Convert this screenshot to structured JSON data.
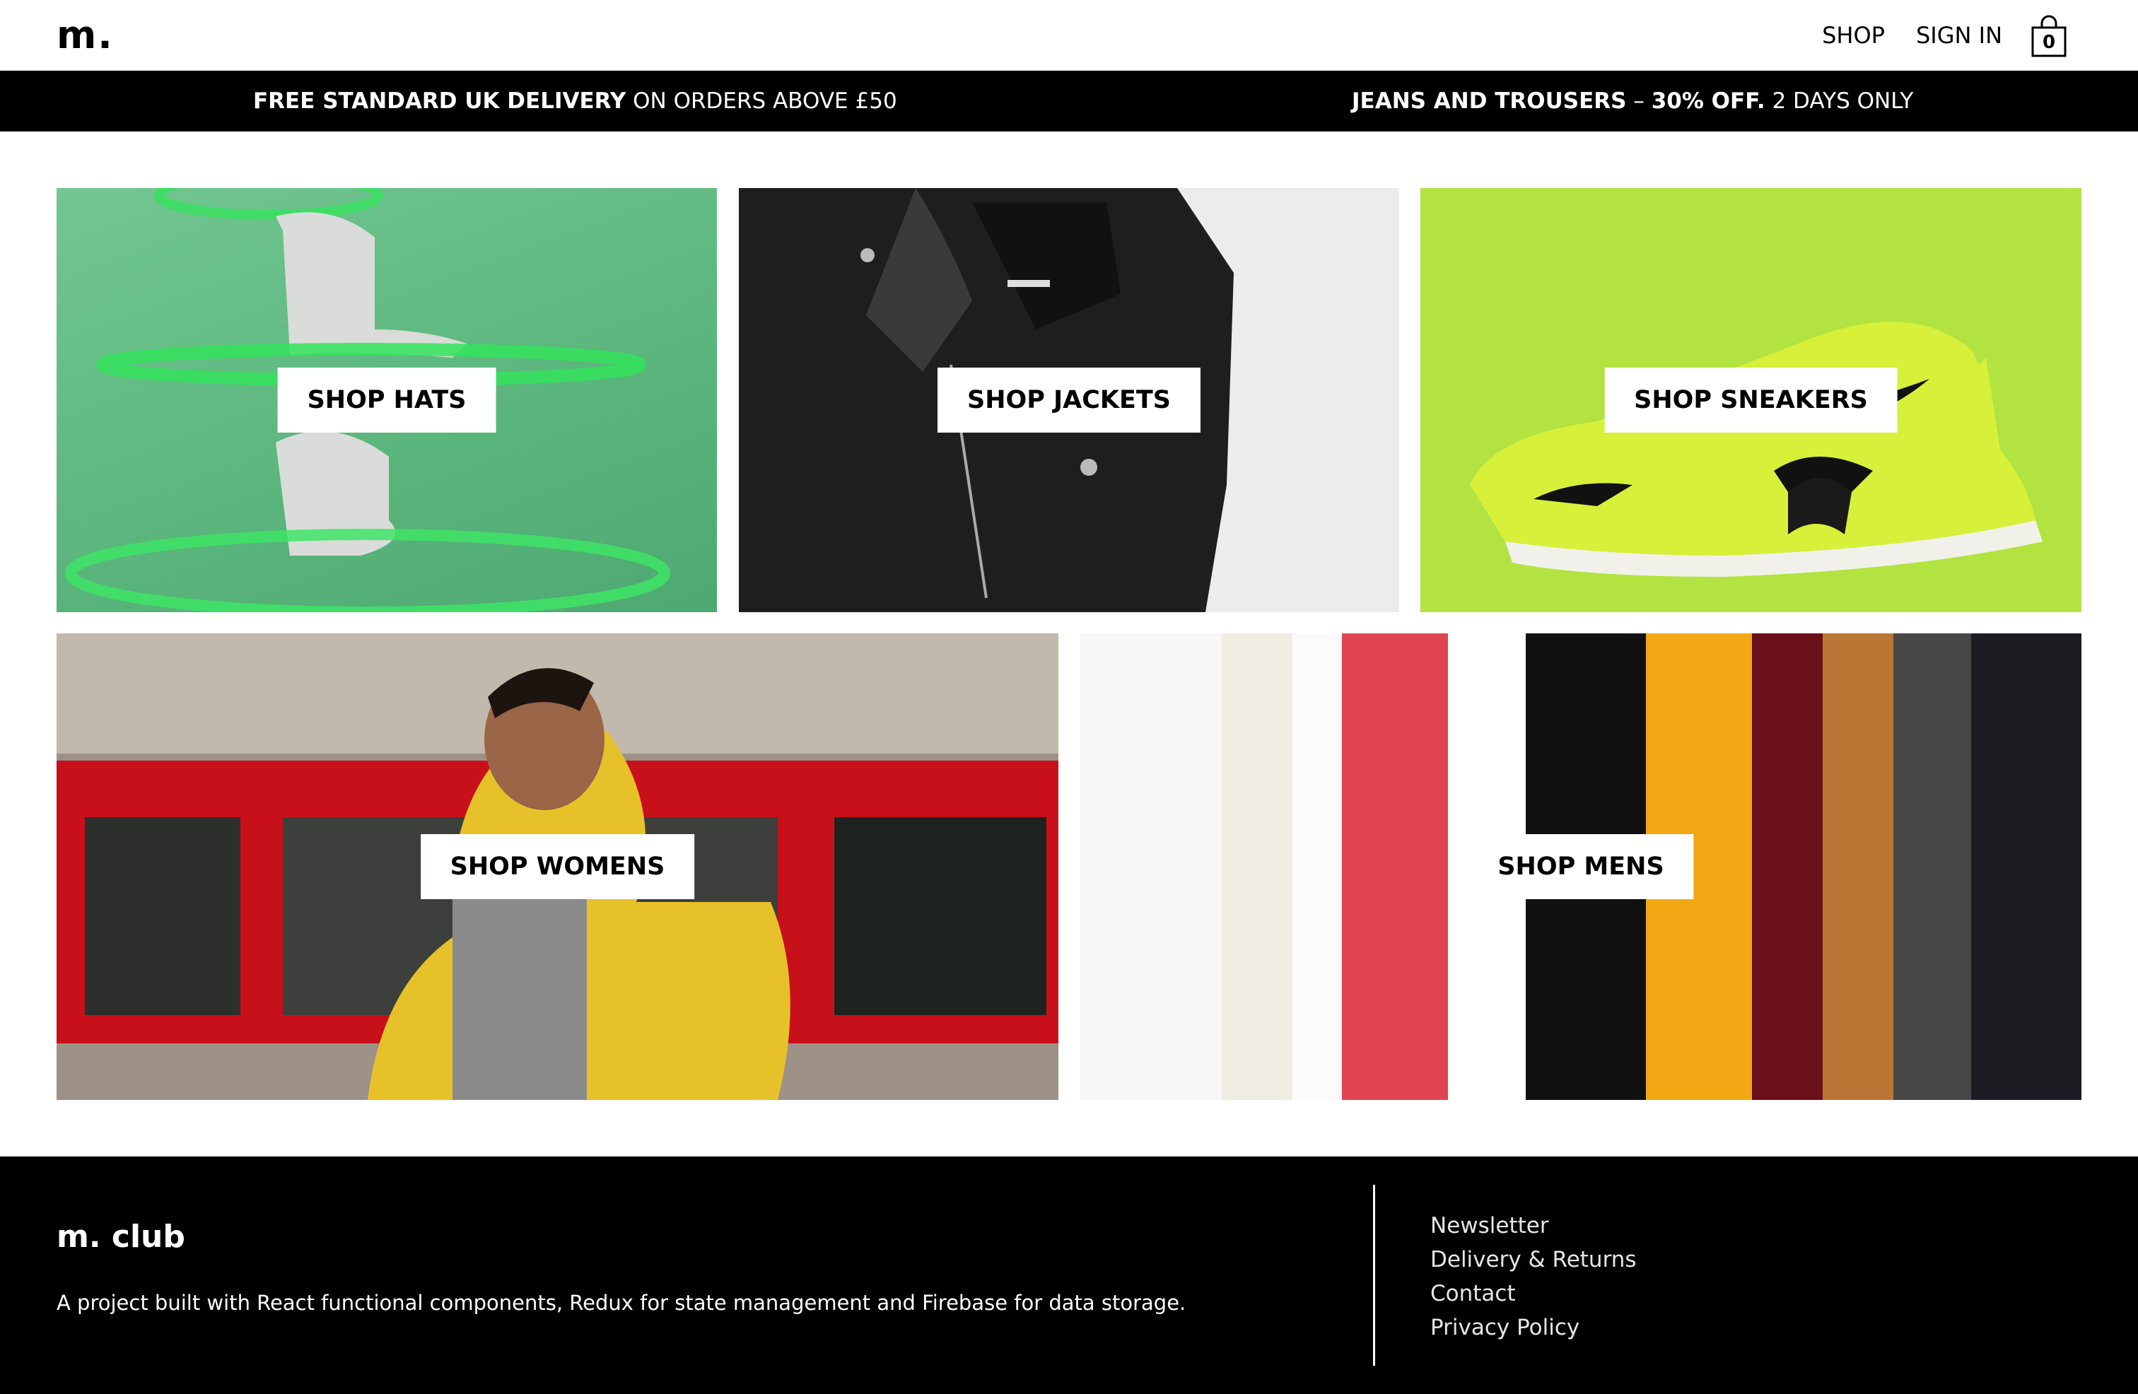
{
  "header": {
    "logo": "m.",
    "nav": {
      "shop": "SHOP",
      "sign_in": "SIGN IN"
    },
    "cart": {
      "count": "0",
      "icon": "shopping-bag-icon"
    }
  },
  "promo": {
    "left": {
      "bold": "FREE STANDARD UK DELIVERY",
      "text": "ON ORDERS ABOVE £50"
    },
    "right": {
      "bold_1": "JEANS AND TROUSERS",
      "dash": "–",
      "bold_2": "30% OFF.",
      "text": "2 DAYS ONLY"
    }
  },
  "categories": [
    {
      "label": "SHOP HATS"
    },
    {
      "label": "SHOP JACKETS"
    },
    {
      "label": "SHOP SNEAKERS"
    },
    {
      "label": "SHOP WOMENS"
    },
    {
      "label": "SHOP MENS"
    }
  ],
  "footer": {
    "title": "m. club",
    "description": "A project built with React functional components, Redux for state management and Firebase for data storage.",
    "links": [
      "Newsletter",
      "Delivery & Returns",
      "Contact",
      "Privacy Policy"
    ]
  },
  "colors": {
    "promo_bg": "#000000",
    "footer_bg": "#000000",
    "sneaker_bg": "#b2e340",
    "hats_bg": "#5ab57c"
  }
}
